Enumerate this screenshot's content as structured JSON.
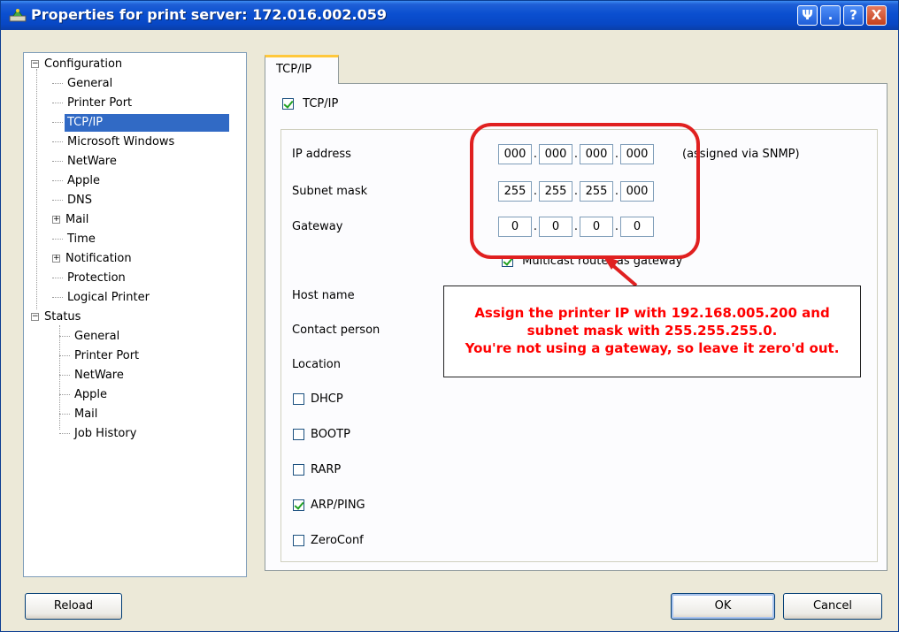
{
  "window": {
    "title": "Properties for print server: 172.016.002.059",
    "buttons": [
      "Ψ",
      ".",
      "?",
      "X"
    ]
  },
  "tree": {
    "groups": [
      {
        "label": "Configuration",
        "items": [
          "General",
          "Printer Port",
          "TCP/IP",
          "Microsoft Windows",
          "NetWare",
          "Apple",
          "DNS",
          "Mail",
          "Time",
          "Notification",
          "Protection",
          "Logical Printer"
        ],
        "expandable_items": [
          "Mail",
          "Notification"
        ],
        "selected": "TCP/IP"
      },
      {
        "label": "Status",
        "items": [
          "General",
          "Printer Port",
          "NetWare",
          "Apple",
          "Mail",
          "Job History"
        ]
      }
    ]
  },
  "tab": {
    "label": "TCP/IP"
  },
  "tcpip_checkbox": {
    "label": "TCP/IP",
    "checked": true
  },
  "fields": {
    "ip_label": "IP address",
    "ip": [
      "000",
      "000",
      "000",
      "000"
    ],
    "ip_note": "(assigned via SNMP)",
    "subnet_label": "Subnet mask",
    "subnet": [
      "255",
      "255",
      "255",
      "000"
    ],
    "gateway_label": "Gateway",
    "gateway": [
      "0",
      "0",
      "0",
      "0"
    ],
    "multicast": {
      "label": "Multicast router as gateway",
      "checked": true
    },
    "host_label": "Host name",
    "contact_label": "Contact person",
    "location_label": "Location"
  },
  "protocols": [
    {
      "label": "DHCP",
      "checked": false
    },
    {
      "label": "BOOTP",
      "checked": false
    },
    {
      "label": "RARP",
      "checked": false
    },
    {
      "label": "ARP/PING",
      "checked": true
    },
    {
      "label": "ZeroConf",
      "checked": false
    }
  ],
  "annotation": {
    "line1": "Assign the printer IP with 192.168.005.200 and",
    "line2": "subnet mask with 255.255.255.0.",
    "line3": "You're not using a gateway, so leave it zero'd out.",
    "color": "#ff0000"
  },
  "footer": {
    "reload": "Reload",
    "ok": "OK",
    "cancel": "Cancel"
  }
}
